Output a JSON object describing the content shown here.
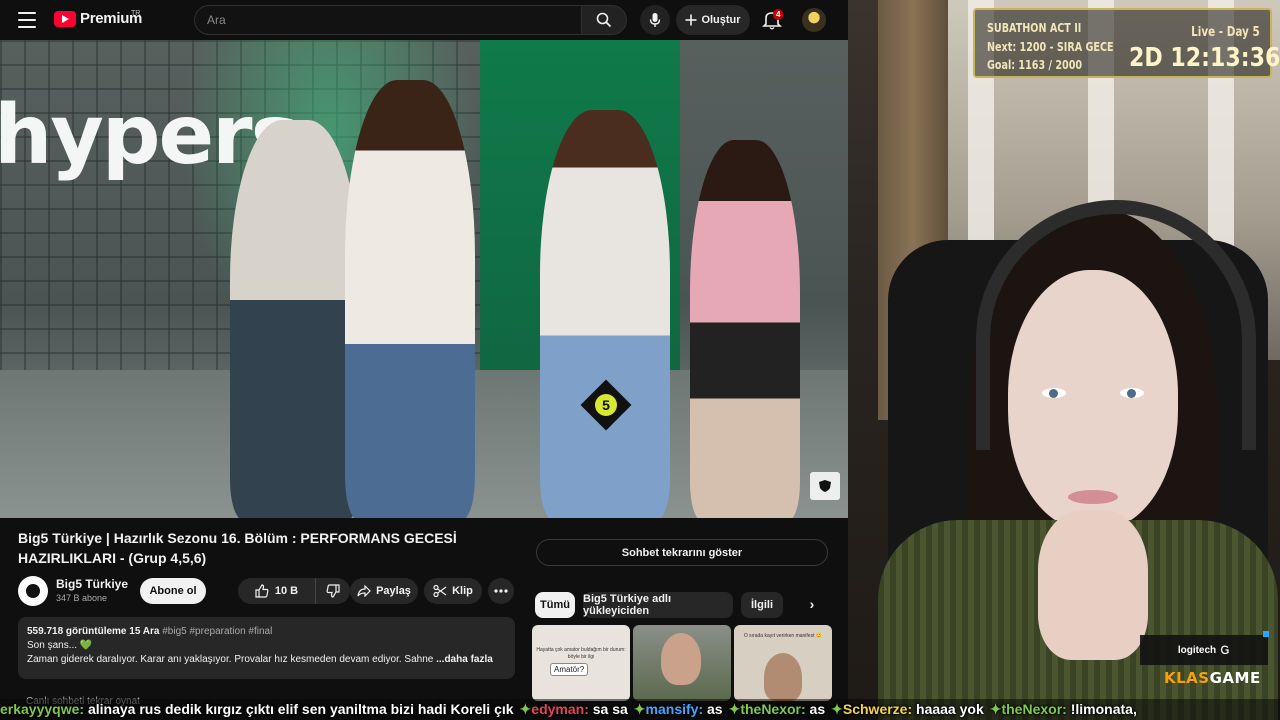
{
  "header": {
    "logo_text": "Premium",
    "country_code": "TR",
    "search_placeholder": "Ara",
    "create_label": "Oluştur",
    "notification_count": "4"
  },
  "video": {
    "overlay_text": "hypers",
    "contestant_number": "5",
    "title": "Big5 Türkiye | Hazırlık Sezonu 16. Bölüm : PERFORMANS GECESİ HAZIRLIKLARI - (Grup 4,5,6)",
    "channel_name": "Big5 Türkiye",
    "channel_subs": "347 B abone",
    "subscribe_label": "Abone ol",
    "like_count": "10 B",
    "share_label": "Paylaş",
    "clip_label": "Klip",
    "description": {
      "views_date": "559.718 görüntüleme  15 Ara",
      "hashtags": "#big5 #preparation #final",
      "line1": "Son şans... 💚",
      "line2": "Zaman giderek daralıyor. Karar anı yaklaşıyor. Provalar hız kesmeden devam ediyor. Sahne",
      "more": "...daha fazla"
    },
    "live_chat_label": "Canlı sohbeti tekrar oynat"
  },
  "sidebar": {
    "chat_replay_button": "Sohbet tekrarını göster",
    "chips": [
      "Tümü",
      "Big5 Türkiye adlı yükleyiciden",
      "İlgili"
    ],
    "thumbnails": [
      {
        "caption": "Hayatta çok amator buldağım bir durum: böyle bir ilgi",
        "tag": "Amatör?",
        "bg": "#e8e3dc"
      },
      {
        "caption": "",
        "tag": "",
        "bg": "#5b6a4e"
      },
      {
        "caption": "O sırada kayıt verirken manifest 😊",
        "tag": "",
        "bg": "#d8cfc3"
      }
    ]
  },
  "stream": {
    "subathon": {
      "title": "SUBATHON ACT II",
      "day": "Live - Day 5",
      "next": "Next: 1200 - SIRA GECE",
      "goal": "Goal: 1163 / 2000",
      "timer": "2D  12:13:36"
    },
    "sponsor": "logitech",
    "channel_logo_a": "KLAS",
    "channel_logo_b": "GAME"
  },
  "chat_ticker": [
    {
      "user": "erkayyyqwe:",
      "msg": " alinaya rus dedik kırgız çıktı elif sen yaniltma bizi hadi Koreli çık",
      "color": "#7ec850"
    },
    {
      "user": "edyman:",
      "msg": " sa sa",
      "color": "#e0485a"
    },
    {
      "user": "mansify:",
      "msg": " as",
      "color": "#4aa3ff"
    },
    {
      "user": "theNexor:",
      "msg": " as",
      "color": "#7ec850"
    },
    {
      "user": "Schwerze:",
      "msg": " haaaa yok",
      "color": "#f3d34a"
    },
    {
      "user": "theNexor:",
      "msg": " !limonata,",
      "color": "#7ec850"
    }
  ]
}
